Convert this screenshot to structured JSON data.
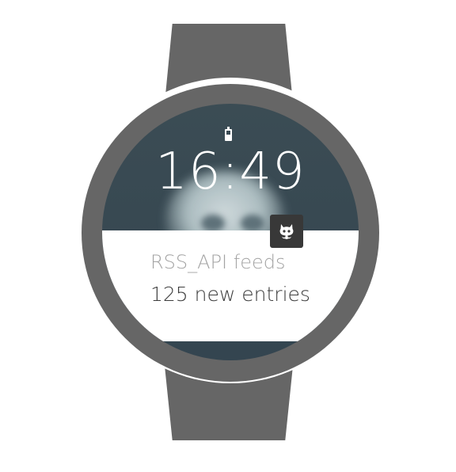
{
  "watch_face": {
    "time": "16:49",
    "battery_icon": "battery-icon"
  },
  "notification": {
    "title": "RSS_API feeds",
    "text": "125 new entries",
    "app_icon": "octocat-icon"
  },
  "colors": {
    "strap": "#666666",
    "screen_background": "#3b4c54",
    "card_background": "#ffffff",
    "title_text": "#a3a3a3",
    "body_text": "#3c3c3c",
    "badge_background": "#383838"
  }
}
